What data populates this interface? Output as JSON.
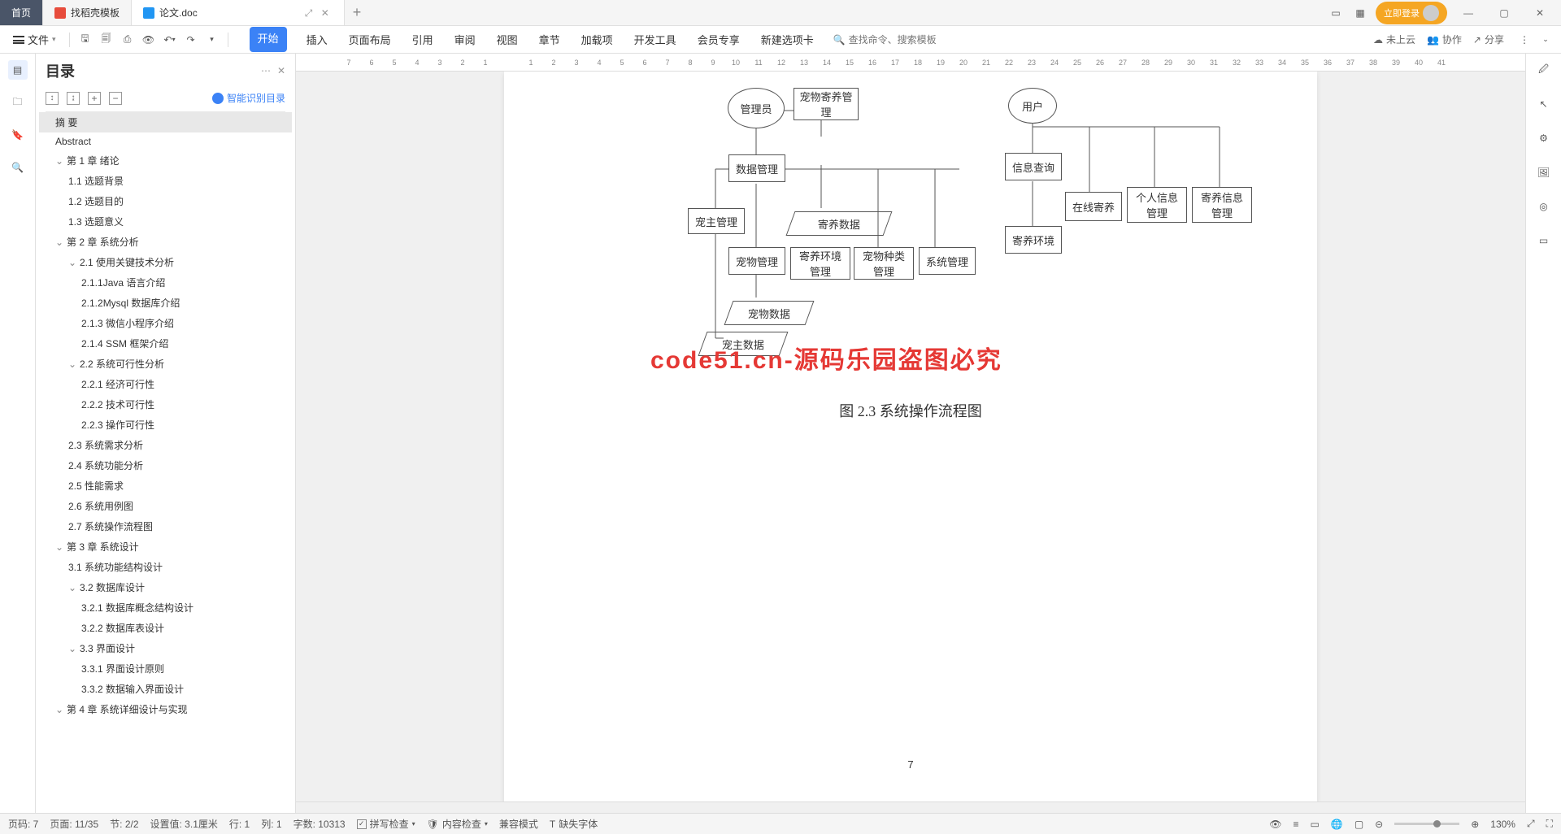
{
  "titlebar": {
    "tabs": [
      {
        "label": "首页"
      },
      {
        "label": "找稻壳模板"
      },
      {
        "label": "论文.doc"
      }
    ],
    "login": "立即登录"
  },
  "menubar": {
    "file": "文件",
    "ribbon": [
      "开始",
      "插入",
      "页面布局",
      "引用",
      "审阅",
      "视图",
      "章节",
      "加载项",
      "开发工具",
      "会员专享",
      "新建选项卡"
    ],
    "search_placeholder": "查找命令、搜索模板",
    "cloud": "未上云",
    "collab": "协作",
    "share": "分享"
  },
  "toc": {
    "title": "目录",
    "smart": "智能识别目录",
    "items": [
      {
        "label": "摘 要",
        "lvl": "l0",
        "sel": true
      },
      {
        "label": "Abstract",
        "lvl": "l0"
      },
      {
        "label": "第 1 章  绪论",
        "lvl": "l1",
        "caret": "v"
      },
      {
        "label": "1.1 选题背景",
        "lvl": "l2"
      },
      {
        "label": "1.2 选题目的",
        "lvl": "l2"
      },
      {
        "label": "1.3 选题意义",
        "lvl": "l2"
      },
      {
        "label": "第 2 章  系统分析",
        "lvl": "l1",
        "caret": "v"
      },
      {
        "label": "2.1 使用关键技术分析",
        "lvl": "l2",
        "caret": "v"
      },
      {
        "label": "2.1.1Java 语言介绍",
        "lvl": "l3"
      },
      {
        "label": "2.1.2Mysql 数据库介绍",
        "lvl": "l3"
      },
      {
        "label": "2.1.3 微信小程序介绍",
        "lvl": "l3"
      },
      {
        "label": "2.1.4 SSM 框架介绍",
        "lvl": "l3"
      },
      {
        "label": "2.2 系统可行性分析",
        "lvl": "l2",
        "caret": "v"
      },
      {
        "label": "2.2.1 经济可行性",
        "lvl": "l3"
      },
      {
        "label": "2.2.2 技术可行性",
        "lvl": "l3"
      },
      {
        "label": "2.2.3 操作可行性",
        "lvl": "l3"
      },
      {
        "label": "2.3 系统需求分析",
        "lvl": "l2"
      },
      {
        "label": "2.4 系统功能分析",
        "lvl": "l2"
      },
      {
        "label": "2.5 性能需求",
        "lvl": "l2"
      },
      {
        "label": "2.6 系统用例图",
        "lvl": "l2"
      },
      {
        "label": "2.7 系统操作流程图",
        "lvl": "l2"
      },
      {
        "label": "第 3 章  系统设计",
        "lvl": "l1",
        "caret": "v"
      },
      {
        "label": "3.1 系统功能结构设计",
        "lvl": "l2"
      },
      {
        "label": "3.2 数据库设计",
        "lvl": "l2",
        "caret": "v"
      },
      {
        "label": "3.2.1 数据库概念结构设计",
        "lvl": "l3"
      },
      {
        "label": "3.2.2 数据库表设计",
        "lvl": "l3"
      },
      {
        "label": "3.3 界面设计",
        "lvl": "l2",
        "caret": "v"
      },
      {
        "label": "3.3.1 界面设计原则",
        "lvl": "l3"
      },
      {
        "label": "3.3.2 数据输入界面设计",
        "lvl": "l3"
      },
      {
        "label": "第 4 章  系统详细设计与实现",
        "lvl": "l1",
        "caret": "v"
      }
    ]
  },
  "doc": {
    "nodes": {
      "admin": "管理员",
      "user": "用户",
      "data_mgmt": "数据管理",
      "boarding_mgmt": "宠物寄养管理",
      "info_query": "信息查询",
      "owner_mgmt": "宠主管理",
      "boarding_data": "寄养数据",
      "pet_mgmt": "宠物管理",
      "env_mgmt": "寄养环境管理",
      "type_mgmt": "宠物种类管理",
      "sys_mgmt": "系统管理",
      "pet_data": "宠物数据",
      "owner_data": "宠主数据",
      "online_board": "在线寄养",
      "personal_info": "个人信息管理",
      "board_info": "寄养信息管理",
      "board_env": "寄养环境"
    },
    "watermark": "code51.cn-源码乐园盗图必究",
    "caption": "图 2.3 系统操作流程图",
    "page_number": "7"
  },
  "ruler": [
    "7",
    "6",
    "5",
    "4",
    "3",
    "2",
    "1",
    "",
    "1",
    "2",
    "3",
    "4",
    "5",
    "6",
    "7",
    "8",
    "9",
    "10",
    "11",
    "12",
    "13",
    "14",
    "15",
    "16",
    "17",
    "18",
    "19",
    "20",
    "21",
    "22",
    "23",
    "24",
    "25",
    "26",
    "27",
    "28",
    "29",
    "30",
    "31",
    "32",
    "33",
    "34",
    "35",
    "36",
    "37",
    "38",
    "39",
    "40",
    "41"
  ],
  "status": {
    "page_code": "页码: 7",
    "page": "页面: 11/35",
    "section": "节: 2/2",
    "set_value": "设置值: 3.1厘米",
    "row": "行: 1",
    "col": "列: 1",
    "words": "字数: 10313",
    "spell": "拼写检查",
    "content": "内容检查",
    "compat": "兼容模式",
    "missing": "缺失字体",
    "zoom": "130%"
  }
}
